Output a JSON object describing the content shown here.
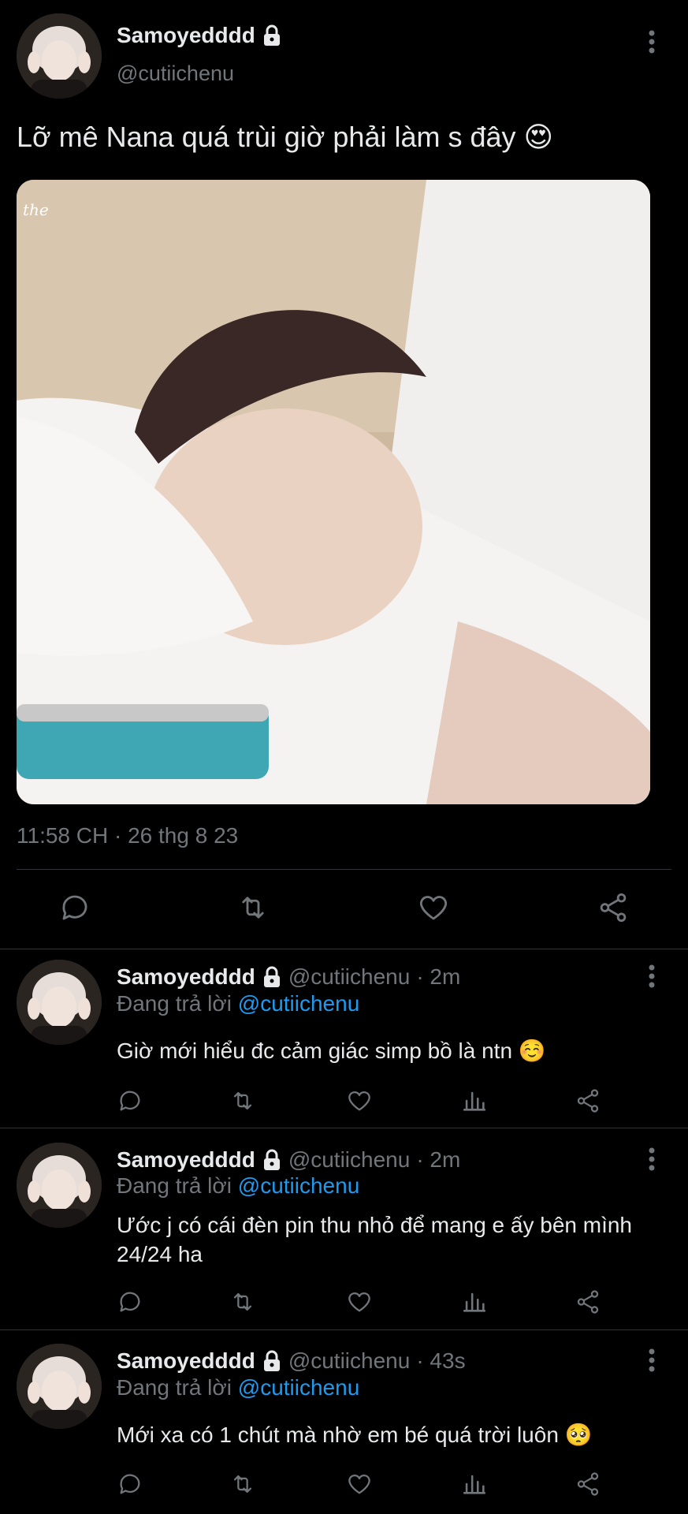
{
  "main_tweet": {
    "display_name": "Samoyedddd",
    "handle": "@cutiichenu",
    "text": "Lỡ mê Nana quá trùi giờ phải làm s đây 😍",
    "timestamp": "11:58 CH · 26 thg 8 23",
    "watermark": "the"
  },
  "replies": [
    {
      "display_name": "Samoyedddd",
      "handle": "@cutiichenu",
      "time": "· 2m",
      "replying_prefix": "Đang trả lời",
      "replying_to": "@cutiichenu",
      "text": "Giờ mới hiểu đc cảm giác simp bồ là ntn ☺️"
    },
    {
      "display_name": "Samoyedddd",
      "handle": "@cutiichenu",
      "time": "· 2m",
      "replying_prefix": "Đang trả lời",
      "replying_to": "@cutiichenu",
      "text": "Ước j có cái đèn pin thu nhỏ để mang e ấy bên mình 24/24 ha"
    },
    {
      "display_name": "Samoyedddd",
      "handle": "@cutiichenu",
      "time": "· 43s",
      "replying_prefix": "Đang trả lời",
      "replying_to": "@cutiichenu",
      "text": "Mới xa có 1 chút mà nhờ em bé quá trời luôn 🥺"
    }
  ],
  "colors": {
    "background": "#000000",
    "text": "#e7e9ea",
    "muted": "#71767b",
    "link": "#1d9bf0",
    "divider": "#2f3336"
  }
}
